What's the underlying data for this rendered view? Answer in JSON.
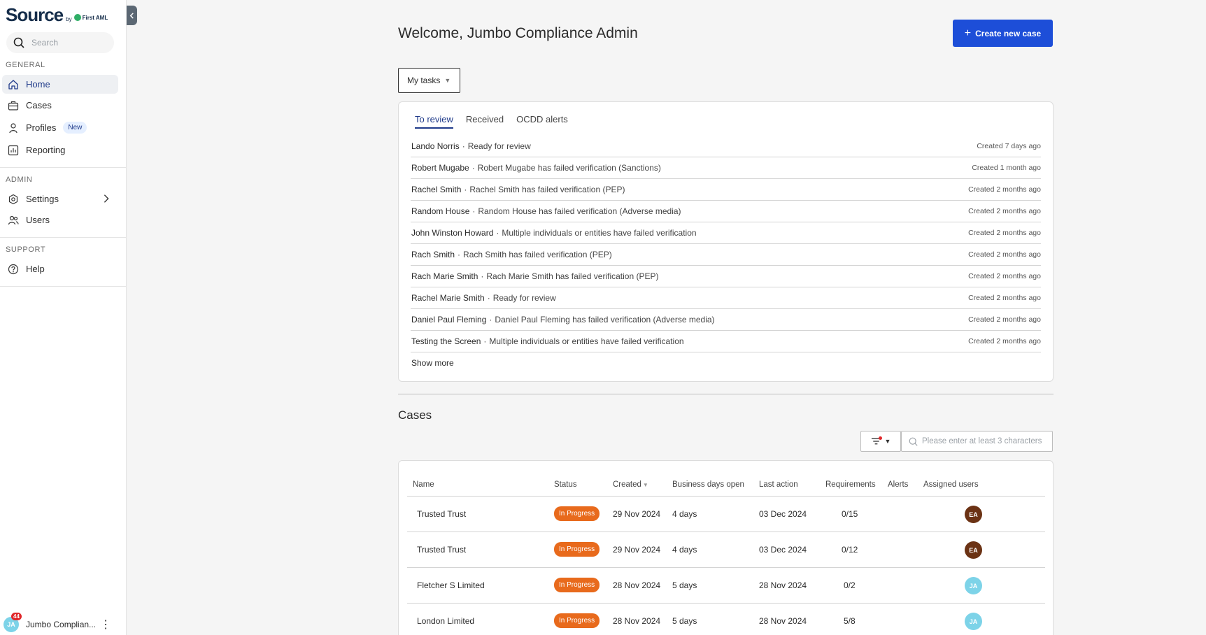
{
  "brand": {
    "name": "Source",
    "by": "by",
    "partner": "First AML"
  },
  "sidebar": {
    "search_placeholder": "Search",
    "sections": {
      "general": "GENERAL",
      "admin": "ADMIN",
      "support": "SUPPORT"
    },
    "items": {
      "home": "Home",
      "cases": "Cases",
      "profiles": "Profiles",
      "profiles_badge": "New",
      "reporting": "Reporting",
      "settings": "Settings",
      "users": "Users",
      "help": "Help"
    },
    "user": {
      "initials": "JA",
      "notifications": "44",
      "name": "Jumbo Complian..."
    }
  },
  "header": {
    "welcome": "Welcome, Jumbo Compliance Admin",
    "create_button": "Create new case"
  },
  "tasks": {
    "dropdown": "My tasks",
    "tabs": [
      "To review",
      "Received",
      "OCDD alerts"
    ],
    "rows": [
      {
        "name": "Lando Norris",
        "desc": "Ready for review",
        "created": "Created 7 days ago"
      },
      {
        "name": "Robert Mugabe",
        "desc": "Robert Mugabe has failed verification (Sanctions)",
        "created": "Created 1 month ago"
      },
      {
        "name": "Rachel Smith",
        "desc": "Rachel Smith has failed verification (PEP)",
        "created": "Created 2 months ago"
      },
      {
        "name": "Random House",
        "desc": "Random House has failed verification (Adverse media)",
        "created": "Created 2 months ago"
      },
      {
        "name": "John Winston Howard",
        "desc": "Multiple individuals or entities have failed verification",
        "created": "Created 2 months ago"
      },
      {
        "name": "Rach Smith",
        "desc": "Rach Smith has failed verification (PEP)",
        "created": "Created 2 months ago"
      },
      {
        "name": "Rach Marie Smith",
        "desc": "Rach Marie Smith has failed verification (PEP)",
        "created": "Created 2 months ago"
      },
      {
        "name": "Rachel Marie Smith",
        "desc": "Ready for review",
        "created": "Created 2 months ago"
      },
      {
        "name": "Daniel Paul Fleming",
        "desc": "Daniel Paul Fleming has failed verification (Adverse media)",
        "created": "Created 2 months ago"
      },
      {
        "name": "Testing the Screen",
        "desc": "Multiple individuals or entities have failed verification",
        "created": "Created 2 months ago"
      }
    ],
    "separator": "·",
    "show_more": "Show more"
  },
  "cases": {
    "title": "Cases",
    "search_placeholder": "Please enter at least 3 characters",
    "columns": [
      "Name",
      "Status",
      "Created",
      "Business days open",
      "Last action",
      "Requirements",
      "Alerts",
      "Assigned users"
    ],
    "rows": [
      {
        "name": "Trusted Trust",
        "status": "In Progress",
        "created": "29 Nov 2024",
        "days_open": "4 days",
        "last_action": "03 Dec 2024",
        "requirements": "0/15",
        "alerts": "",
        "assigned": "EA",
        "avatar_color": "#6b3214"
      },
      {
        "name": "Trusted Trust",
        "status": "In Progress",
        "created": "29 Nov 2024",
        "days_open": "4 days",
        "last_action": "03 Dec 2024",
        "requirements": "0/12",
        "alerts": "",
        "assigned": "EA",
        "avatar_color": "#6b3214"
      },
      {
        "name": "Fletcher S Limited",
        "status": "In Progress",
        "created": "28 Nov 2024",
        "days_open": "5 days",
        "last_action": "28 Nov 2024",
        "requirements": "0/2",
        "alerts": "",
        "assigned": "JA",
        "avatar_color": "#7dd3e8"
      },
      {
        "name": "London Limited",
        "status": "In Progress",
        "created": "28 Nov 2024",
        "days_open": "5 days",
        "last_action": "28 Nov 2024",
        "requirements": "5/8",
        "alerts": "",
        "assigned": "JA",
        "avatar_color": "#7dd3e8"
      }
    ]
  },
  "colors": {
    "primary": "#1d4ed8",
    "status_in_progress": "#e86a1c",
    "notification": "#e0282b",
    "brand": "#152d4a"
  }
}
